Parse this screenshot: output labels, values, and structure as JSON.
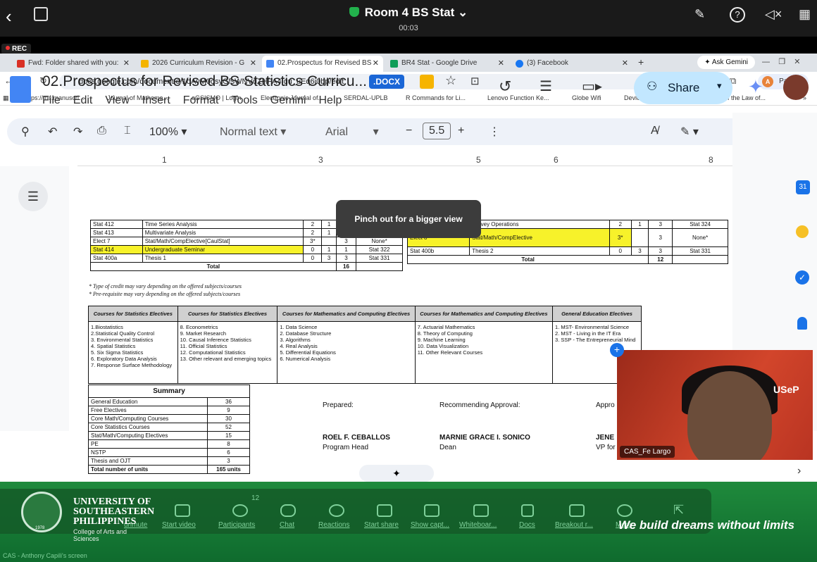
{
  "zoom": {
    "room_title": "Room 4 BS Stat",
    "timer": "00:03",
    "rec": "REC"
  },
  "browser": {
    "tabs": [
      {
        "label": "Fwd: Folder shared with you:",
        "color": "#d93025"
      },
      {
        "label": "2026 Curriculum Revision - G",
        "color": "#f4b400"
      },
      {
        "label": "02.Prospectus for Revised BS",
        "color": "#4285f4"
      },
      {
        "label": "BR4 Stat - Google Drive",
        "color": "#0f9d58"
      },
      {
        "label": "(3) Facebook",
        "color": "#1877f2"
      }
    ],
    "gemini_button": "Ask Gemini",
    "url": "docs.google.com/document/d/1oAyM0qsyGfsWNVdZHPA4Igu_uEq6i0bp/edit",
    "profile": {
      "initial": "A",
      "status": "Paused"
    },
    "bookmarks": [
      "https://mc.manuscri...",
      "Journal of Mathema...",
      "eGSISMO | Login",
      "Electronic Journal of...",
      "SERDAL-UPLB",
      "R Commands for Li...",
      "Lenovo Function Ke...",
      "Globe Wifi",
      "Device State Inform...",
      "Proof of the Law of..."
    ]
  },
  "doc": {
    "title": "02.Prospectus for Revised BS Statistics Curricu...",
    "badge": ".DOCX",
    "menu": [
      "File",
      "Edit",
      "View",
      "Insert",
      "Format",
      "Tools",
      "Gemini",
      "Help"
    ],
    "share_label": "Share",
    "toolbar": {
      "zoom": "100%",
      "style": "Normal text",
      "font": "Arial",
      "size": "5.5"
    },
    "ruler": [
      "1",
      "3",
      "5",
      "6",
      "8"
    ],
    "left_table": {
      "rows": [
        [
          "Stat 412",
          "Time Series Analysis",
          "2",
          "1",
          "3",
          "Stat 322"
        ],
        [
          "Stat 413",
          "Multivariate Analysis",
          "2",
          "1",
          "3",
          "Stat 322"
        ],
        [
          "Elect 7",
          "Stat/Math/CompElective[CaulStat]",
          "3*",
          "",
          "3",
          "None*"
        ],
        [
          "Stat 414",
          "Undergraduate Seminar",
          "0",
          "1",
          "1",
          "Stat 322"
        ],
        [
          "Stat 400a",
          "Thesis 1",
          "0",
          "3",
          "3",
          "Stat 331"
        ]
      ],
      "total_label": "Total",
      "total": "16"
    },
    "right_table": {
      "rows": [
        [
          "Stat 423",
          "Survey Operations",
          "2",
          "1",
          "3",
          "Stat 324"
        ],
        [
          "Elect 8",
          "Stat/Math/CompElective",
          "3*",
          "",
          "3",
          "None*"
        ],
        [
          "Stat 400b",
          "Thesis 2",
          "0",
          "3",
          "3",
          "Stat 331"
        ]
      ],
      "total_label": "Total",
      "total": "12"
    },
    "notes": [
      "* Type of credit may vary depending on the offered subjects/courses",
      "* Pre-requisite may vary depending on the offered subjects/courses"
    ],
    "electives": {
      "headers": [
        "Courses for Statistics Electives",
        "Courses for Statistics Electives",
        "Courses for Mathematics and Computing Electives",
        "Courses for Mathematics and Computing Electives",
        "General Education Electives"
      ],
      "columns": [
        [
          "1.Biostatistics",
          "2.Statistical Quality Control",
          "3. Environmental Statistics",
          "4. Spatial Statistics",
          "5. Six Sigma Statistics",
          "6. Exploratory Data Analysis",
          "7. Response Surface Methodology"
        ],
        [
          "8. Econometrics",
          "9. Market Research",
          "10. Causal Inference Statistics",
          "11. Official Statistics",
          "12. Computational Statistics",
          "13. Other relevant and emerging topics"
        ],
        [
          "1. Data Science",
          "2. Database Structure",
          "3. Algorithms",
          "4. Real Analysis",
          "5. Differential Equations",
          "6. Numerical Analysis"
        ],
        [
          "7. Actuarial Mathematics",
          "8. Theory of Computing",
          "9. Machine Learning",
          "10. Data Visualization",
          "11. Other Relevant Courses"
        ],
        [
          "1. MST- Environmental Science",
          "2. MST - Living in the IT Era",
          "3. SSP - The Entrepreneurial Mind"
        ]
      ]
    },
    "summary": {
      "title": "Summary",
      "rows": [
        [
          "General Education",
          "36"
        ],
        [
          "Free Electives",
          "9"
        ],
        [
          "Core Math/Computing Courses",
          "30"
        ],
        [
          "Core Statistics Courses",
          "52"
        ],
        [
          "Stat/Math/Computing Electives",
          "15"
        ],
        [
          "PE",
          "8"
        ],
        [
          "NSTP",
          "6"
        ],
        [
          "Thesis and OJT",
          "3"
        ]
      ],
      "total_label": "Total number of units",
      "total": "165 units"
    },
    "signatures": {
      "prepared_label": "Prepared:",
      "recommending_label": "Recommending Approval:",
      "approved_label": "Appro",
      "prepared_name": "ROEL F. CEBALLOS",
      "prepared_role": "Program Head",
      "rec_name": "MARNIE GRACE I. SONICO",
      "rec_role": "Dean",
      "app_name": "JENE",
      "app_role": "VP for"
    },
    "toast": "Pinch out for a bigger view"
  },
  "video": {
    "participant": "CAS_Fe Largo",
    "logo_text": "USeP"
  },
  "meeting_bar": [
    "unmute",
    "Start video",
    "Participants",
    "Chat",
    "Reactions",
    "Start share",
    "Show capt...",
    "Whiteboar...",
    "Docs",
    "Breakout r...",
    "More"
  ],
  "participants_count": "12",
  "banner": {
    "university": [
      "UNIVERSITY OF",
      "SOUTHEASTERN",
      "PHILIPPINES"
    ],
    "college": [
      "College of Arts and",
      "Sciences"
    ],
    "slogan": "We build dreams without limits",
    "seal_year": "1978",
    "screen_label": "CAS - Anthony Capili's screen"
  }
}
